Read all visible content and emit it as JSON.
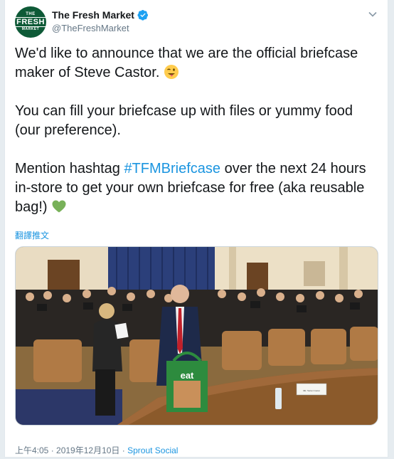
{
  "tweet": {
    "avatar": {
      "line1": "THE",
      "line2": "FRESH",
      "line3": "MARKET"
    },
    "display_name": "The Fresh Market",
    "handle": "@TheFreshMarket",
    "paragraph1": "We'd like to announce that we are the official briefcase maker of Steve Castor.",
    "paragraph2": "You can fill your briefcase up with files or yummy food (our preference).",
    "paragraph3_before": "Mention hashtag ",
    "hashtag": "#TFMBriefcase",
    "paragraph3_after": " over the next 24 hours in-store to get your own briefcase for free (aka reusable bag!)",
    "translate_label": "翻譯推文",
    "bag_text": "eat",
    "nameplate_text": "Mr. Steve Castor",
    "timestamp": "上午4:05 · 2019年12月10日",
    "separator": " · ",
    "source": "Sprout Social"
  },
  "icons": {
    "verified": "verified-badge-icon",
    "caret": "chevron-down-icon",
    "emoji1": "winking-tongue-face-emoji",
    "emoji2": "green-heart-emoji"
  },
  "colors": {
    "link": "#1b95e0",
    "brand_green": "#0e5a37",
    "text": "#14171a",
    "secondary": "#657786"
  }
}
